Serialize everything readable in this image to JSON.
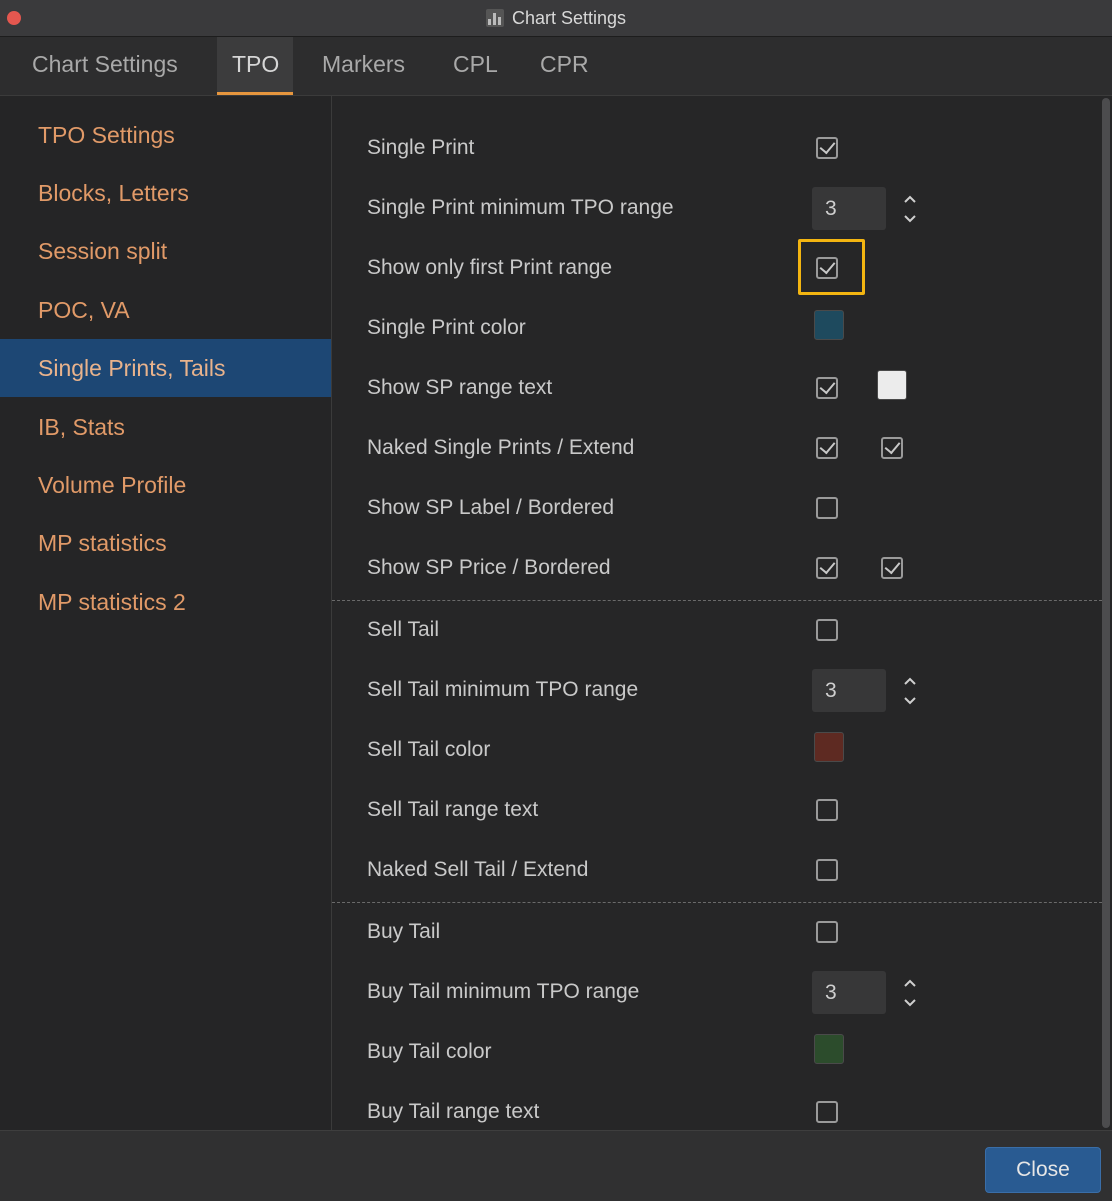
{
  "window": {
    "title": "Chart Settings"
  },
  "tabs": [
    {
      "label": "Chart Settings",
      "active": false
    },
    {
      "label": "TPO",
      "active": true
    },
    {
      "label": "Markers",
      "active": false
    },
    {
      "label": "CPL",
      "active": false
    },
    {
      "label": "CPR",
      "active": false
    }
  ],
  "sidebar": {
    "items": [
      {
        "label": "TPO Settings"
      },
      {
        "label": "Blocks, Letters"
      },
      {
        "label": "Session split"
      },
      {
        "label": "POC, VA"
      },
      {
        "label": "Single Prints, Tails",
        "active": true
      },
      {
        "label": "IB, Stats"
      },
      {
        "label": "Volume Profile"
      },
      {
        "label": "MP statistics"
      },
      {
        "label": "MP statistics 2"
      }
    ]
  },
  "settings": {
    "single_print": {
      "label": "Single Print",
      "checked": true
    },
    "single_print_min": {
      "label": "Single Print minimum TPO range",
      "value": "3"
    },
    "show_first_range": {
      "label": "Show only first Print range",
      "checked": true
    },
    "single_print_color": {
      "label": "Single Print color",
      "color": "#1e4a5e"
    },
    "show_sp_range_text": {
      "label": "Show SP range text",
      "checked": true,
      "color": "#ececec"
    },
    "naked_single_prints": {
      "label": "Naked Single Prints / Extend",
      "checked": true,
      "extend_checked": true
    },
    "show_sp_label": {
      "label": "Show SP Label / Bordered",
      "checked": false
    },
    "show_sp_price": {
      "label": "Show SP Price / Bordered",
      "checked": true,
      "bordered_checked": true
    },
    "sell_tail": {
      "label": "Sell Tail",
      "checked": false
    },
    "sell_tail_min": {
      "label": "Sell Tail minimum TPO range",
      "value": "3"
    },
    "sell_tail_color": {
      "label": "Sell Tail color",
      "color": "#5e2a22"
    },
    "sell_tail_range_text": {
      "label": "Sell Tail range text",
      "checked": false
    },
    "naked_sell_tail": {
      "label": "Naked Sell Tail / Extend",
      "checked": false
    },
    "buy_tail": {
      "label": "Buy Tail",
      "checked": false
    },
    "buy_tail_min": {
      "label": "Buy Tail minimum TPO range",
      "value": "3"
    },
    "buy_tail_color": {
      "label": "Buy Tail color",
      "color": "#2c4c2c"
    },
    "buy_tail_range_text": {
      "label": "Buy Tail range text",
      "checked": false
    }
  },
  "footer": {
    "close_label": "Close"
  }
}
